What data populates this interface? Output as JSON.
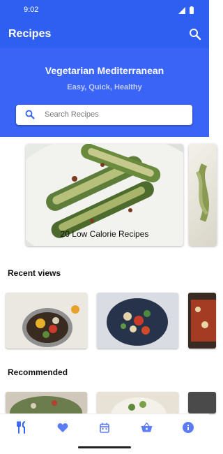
{
  "status_bar": {
    "time": "9:02",
    "icons": [
      "signal-icon",
      "battery-icon"
    ]
  },
  "app_bar": {
    "title": "Recipes",
    "search_icon": "search-icon"
  },
  "hero": {
    "title": "Vegetarian Mediterranean",
    "subtitle": "Easy, Quick, Healthy",
    "search_placeholder": "Search Recipes"
  },
  "featured": [
    {
      "label": "20 Low Calorie Recipes"
    },
    {
      "label": ""
    }
  ],
  "sections": {
    "recent_title": "Recent views",
    "recommended_title": "Recommended"
  },
  "bottom_nav": {
    "items": [
      "recipes-icon",
      "favorites-icon",
      "calendar-icon",
      "basket-icon",
      "info-icon"
    ],
    "active": "recipes-icon"
  },
  "colors": {
    "primary": "#2f5ff0",
    "hero": "#3a64f6",
    "nav_icon": "#5b7cf2"
  }
}
